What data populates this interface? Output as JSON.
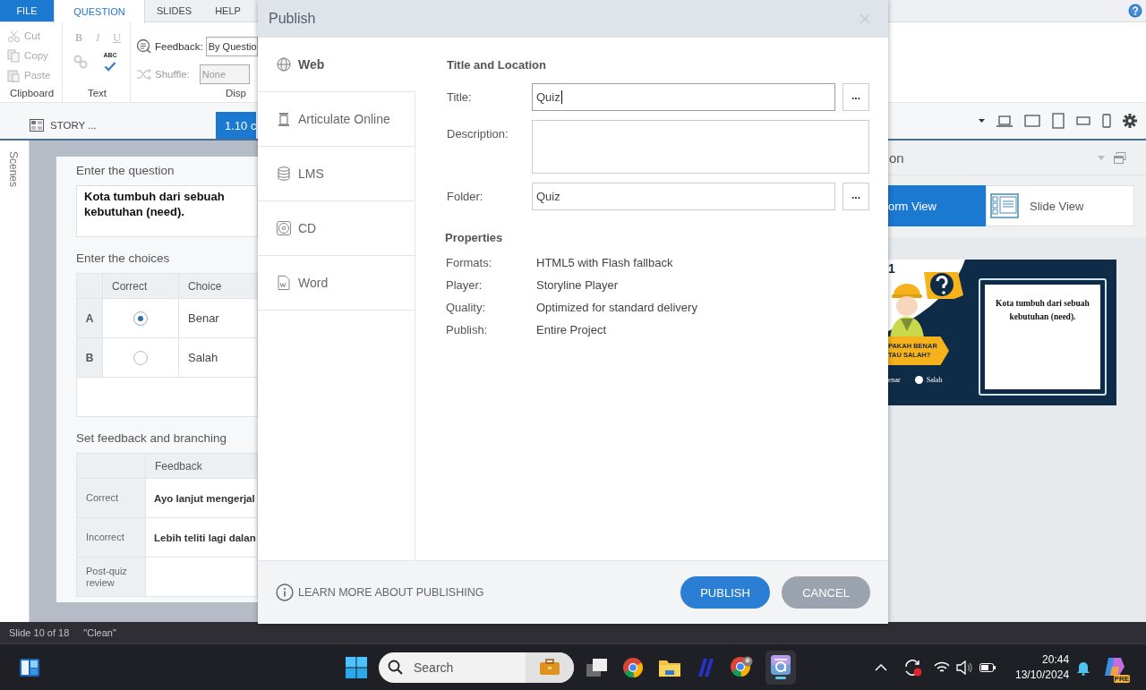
{
  "ribbon_tabs": [
    {
      "label": "FILE",
      "kind": "file",
      "selected": false
    },
    {
      "label": "QUESTION",
      "kind": "tab",
      "selected": true
    },
    {
      "label": "SLIDES",
      "kind": "tab",
      "selected": false
    },
    {
      "label": "HELP",
      "kind": "tab",
      "selected": false
    }
  ],
  "clipboard": {
    "items": [
      {
        "label": "Cut",
        "disabled": true
      },
      {
        "label": "Copy",
        "disabled": true
      },
      {
        "label": "Paste",
        "disabled": true
      }
    ],
    "group_label": "Clipboard"
  },
  "text_group": {
    "format_buttons": [
      {
        "label": "B",
        "disabled": true
      },
      {
        "label": "I",
        "disabled": true
      },
      {
        "label": "U",
        "disabled": true
      }
    ],
    "spellcheck_label": "ABC",
    "group_label": "Text"
  },
  "display_group": {
    "feedback": {
      "label": "Feedback:",
      "value": "By Questio",
      "disabled": false
    },
    "shuffle": {
      "label": "Shuffle:",
      "value": "None",
      "disabled": true
    },
    "group_label": "Disp"
  },
  "view_tabs": [
    {
      "label": "STORY ...",
      "selected": false
    },
    {
      "label": "1.10 c",
      "selected": true
    }
  ],
  "scenes_label": "Scenes",
  "question": {
    "heading": "Enter the question",
    "text": "Kota tumbuh dari sebuah kebutuhan (need)."
  },
  "choices": {
    "heading": "Enter the choices",
    "columns": [
      "Correct",
      "Choice"
    ],
    "rows": [
      {
        "letter": "A",
        "selected": true,
        "text": "Benar"
      },
      {
        "letter": "B",
        "selected": false,
        "text": "Salah"
      }
    ]
  },
  "feedback": {
    "heading": "Set feedback and branching",
    "column": "Feedback",
    "rows": [
      {
        "label": "Correct",
        "text": "Ayo lanjut mengerjal"
      },
      {
        "label": "Incorrect",
        "text": "Lebih teliti lagi dalan"
      },
      {
        "label": "Post-quiz review"
      }
    ]
  },
  "right_panel": {
    "title": "on",
    "views": [
      {
        "label": "orm View",
        "selected": true
      },
      {
        "label": "Slide View",
        "selected": false
      }
    ],
    "slide": {
      "number": "1",
      "banner": [
        "PAKAH BENAR",
        "TAU SALAH?"
      ],
      "options": [
        "enar",
        "Salah"
      ],
      "question": "Kota tumbuh dari sebuah kebutuhan (need)."
    }
  },
  "status_bar": [
    "Slide 10 of 18",
    "\"Clean\""
  ],
  "taskbar": {
    "search_placeholder": "Search",
    "badge": "PRE",
    "time": "20:44",
    "date": "13/10/2024"
  },
  "publish_dialog": {
    "title": "Publish",
    "targets": [
      {
        "label": "Web",
        "selected": true
      },
      {
        "label": "Articulate Online",
        "selected": false
      },
      {
        "label": "LMS",
        "selected": false
      },
      {
        "label": "CD",
        "selected": false
      },
      {
        "label": "Word",
        "selected": false
      }
    ],
    "section_title": "Title and Location",
    "fields": [
      {
        "label": "Title:",
        "kind": "text",
        "value": "Quiz",
        "focused": true,
        "button": "..."
      },
      {
        "label": "Description:",
        "kind": "textarea"
      },
      {
        "label": "Folder:",
        "kind": "text",
        "value": "Quiz",
        "focused": false,
        "button": "..."
      }
    ],
    "properties_title": "Properties",
    "properties": [
      {
        "label": "Formats:",
        "value": "HTML5 with Flash fallback"
      },
      {
        "label": "Player:",
        "value": "Storyline Player"
      },
      {
        "label": "Quality:",
        "value": "Optimized for standard delivery"
      },
      {
        "label": "Publish:",
        "value": "Entire Project"
      }
    ],
    "learn_more": "LEARN MORE ABOUT PUBLISHING",
    "buttons": [
      {
        "label": "PUBLISH",
        "kind": "primary"
      },
      {
        "label": "CANCEL",
        "kind": "secondary"
      }
    ]
  }
}
